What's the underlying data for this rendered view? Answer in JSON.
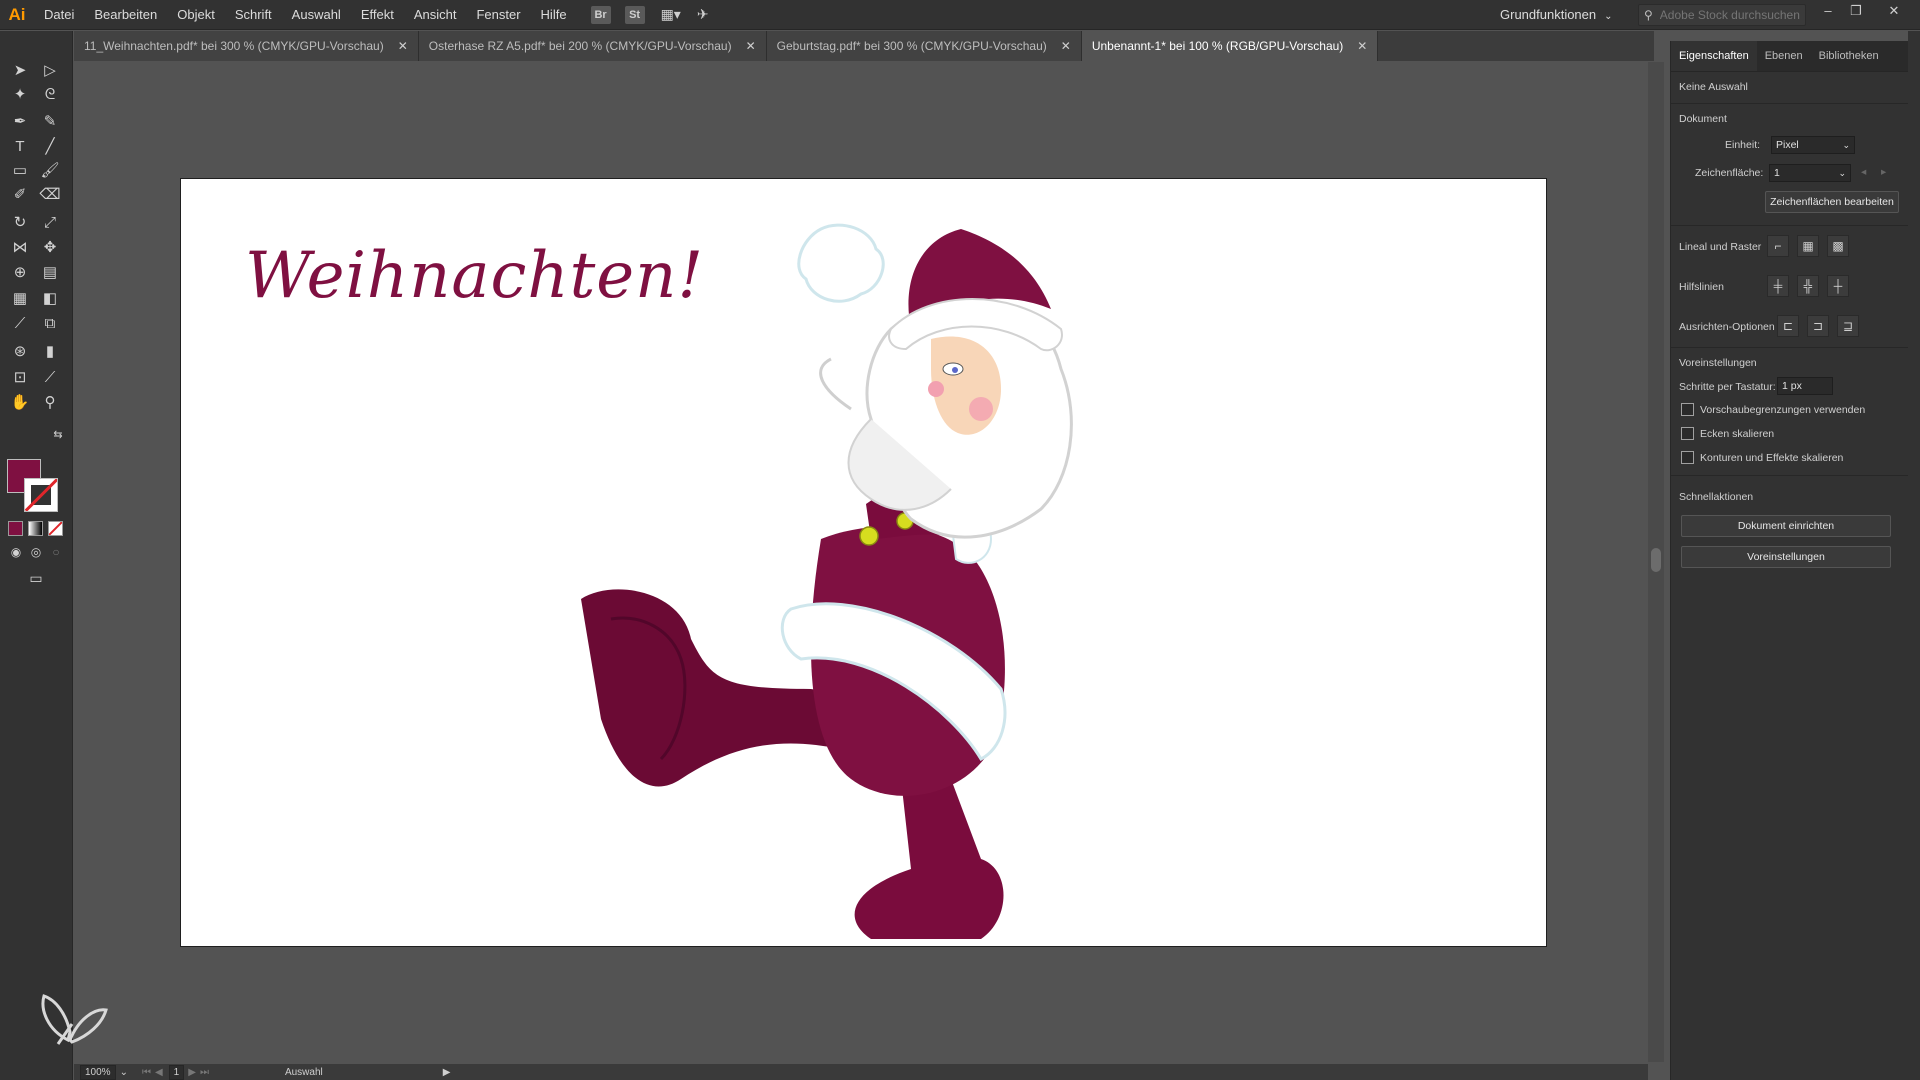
{
  "app": {
    "logo": "Ai"
  },
  "menu": [
    "Datei",
    "Bearbeiten",
    "Objekt",
    "Schrift",
    "Auswahl",
    "Effekt",
    "Ansicht",
    "Fenster",
    "Hilfe"
  ],
  "menubar_icons": {
    "bridge": "Br",
    "stock": "St"
  },
  "workspace": {
    "label": "Grundfunktionen"
  },
  "stock_search": {
    "placeholder": "Adobe Stock durchsuchen"
  },
  "tabs": [
    {
      "label": "11_Weihnachten.pdf* bei 300 % (CMYK/GPU-Vorschau)",
      "active": false
    },
    {
      "label": "Osterhase RZ A5.pdf* bei 200 % (CMYK/GPU-Vorschau)",
      "active": false
    },
    {
      "label": "Geburtstag.pdf* bei 300 % (CMYK/GPU-Vorschau)",
      "active": false
    },
    {
      "label": "Unbenannt-1* bei 100 % (RGB/GPU-Vorschau)",
      "active": true
    }
  ],
  "artwork": {
    "headline": "Weihnachten!",
    "accent_color": "#7f1041"
  },
  "tools": {
    "fill_color": "#7f1041",
    "stroke_color": "none"
  },
  "status": {
    "zoom": "100%",
    "artboard": "1",
    "mode": "Auswahl"
  },
  "properties": {
    "tabs": [
      "Eigenschaften",
      "Ebenen",
      "Bibliotheken"
    ],
    "selection": "Keine Auswahl",
    "document": {
      "title": "Dokument",
      "unit_label": "Einheit:",
      "unit_value": "Pixel",
      "artboard_label": "Zeichenfläche:",
      "artboard_value": "1",
      "edit_button": "Zeichenflächen bearbeiten"
    },
    "rulers_label": "Lineal und Raster",
    "guides_label": "Hilfslinien",
    "align_label": "Ausrichten-Optionen",
    "preferences": {
      "title": "Voreinstellungen",
      "keyboard_label": "Schritte per Tastatur:",
      "keyboard_value": "1 px",
      "checks": [
        "Vorschaubegrenzungen verwenden",
        "Ecken skalieren",
        "Konturen und Effekte skalieren"
      ]
    },
    "quick_actions": {
      "title": "Schnellaktionen",
      "buttons": [
        "Dokument einrichten",
        "Voreinstellungen"
      ]
    }
  }
}
